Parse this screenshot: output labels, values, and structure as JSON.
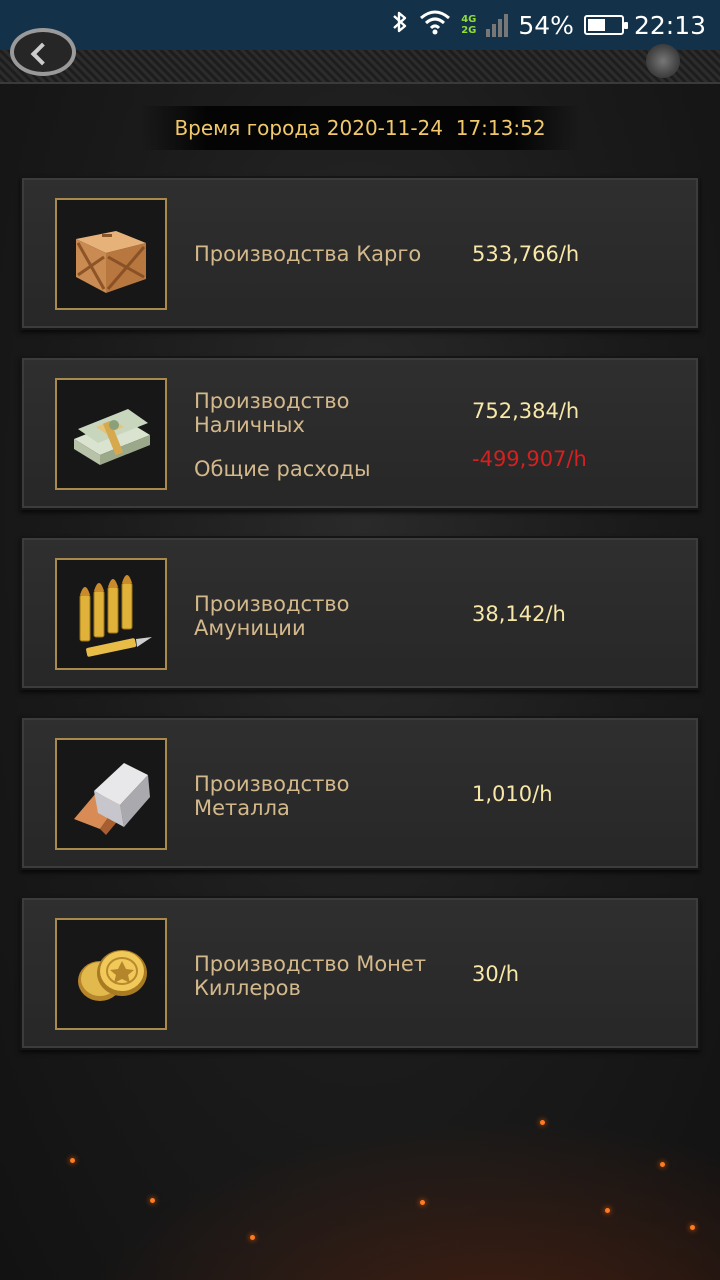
{
  "status_bar": {
    "network_top": "4G",
    "network_bottom": "2G",
    "battery": "54%",
    "battery_level": 0.54,
    "time": "22:13"
  },
  "city_time": "Время города 2020-11-24  17:13:52",
  "rows": [
    {
      "icon": "cargo-crate-icon",
      "label": "Производства Карго",
      "value": "533,766/h"
    },
    {
      "icon": "cash-stack-icon",
      "label": "Производство Наличных",
      "value": "752,384/h",
      "expense_label": "Общие расходы",
      "expense_value": "-499,907/h"
    },
    {
      "icon": "ammo-bullets-icon",
      "label": "Производство Амуниции",
      "value": "38,142/h"
    },
    {
      "icon": "metal-ingot-icon",
      "label": "Производство Металла",
      "value": "1,010/h"
    },
    {
      "icon": "killer-coins-icon",
      "label": "Производство Монет Киллеров",
      "value": "30/h"
    }
  ]
}
